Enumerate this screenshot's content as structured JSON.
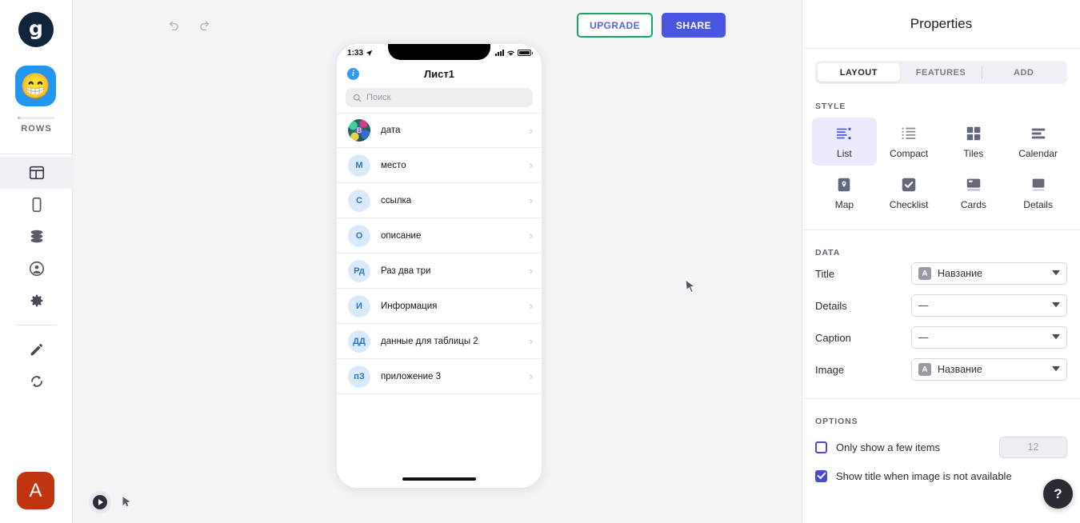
{
  "rail": {
    "brand_logo_letter": "g",
    "app_tile_emoji": "😁",
    "app_label": "ROWS",
    "icons": [
      {
        "name": "layout-icon",
        "label": "Layout",
        "active": true
      },
      {
        "name": "screen-icon",
        "label": "Screens",
        "active": false
      },
      {
        "name": "database-icon",
        "label": "Data",
        "active": false
      },
      {
        "name": "users-icon",
        "label": "Users",
        "active": false
      },
      {
        "name": "gear-icon",
        "label": "Settings",
        "active": false
      },
      {
        "name": "pencil-icon",
        "label": "Design",
        "active": false
      },
      {
        "name": "refresh-icon",
        "label": "Refresh",
        "active": false
      }
    ],
    "avatar_letter": "A",
    "avatar_color": "#c0340f"
  },
  "toolbar": {
    "undo_label": "Undo",
    "redo_label": "Redo",
    "upgrade_label": "UPGRADE",
    "share_label": "SHARE",
    "upgrade_border_color": "#17a762",
    "upgrade_text_color": "#5a62e8",
    "share_bg_color": "#4a56e2"
  },
  "preview": {
    "status_bar": {
      "time": "1:33",
      "location_arrow": "➤"
    },
    "nav_title": "Лист1",
    "info_letter": "i",
    "search_placeholder": "Поиск",
    "rows": [
      {
        "initials": "В",
        "label": "дата",
        "has_image": true
      },
      {
        "initials": "М",
        "label": "место",
        "has_image": false
      },
      {
        "initials": "С",
        "label": "ссылка",
        "has_image": false
      },
      {
        "initials": "О",
        "label": "описание",
        "has_image": false
      },
      {
        "initials": "Рд",
        "label": "Раз два три",
        "has_image": false
      },
      {
        "initials": "И",
        "label": "Информация",
        "has_image": false
      },
      {
        "initials": "ДД",
        "label": "данные для таблицы 2",
        "has_image": false
      },
      {
        "initials": "пЗ",
        "label": "приложение 3",
        "has_image": false
      }
    ],
    "chevron": "›"
  },
  "canvas_controls": {
    "play_label": "Preview",
    "pointer_label": "Select tool"
  },
  "panel": {
    "title": "Properties",
    "tabs": [
      {
        "label": "LAYOUT",
        "active": true
      },
      {
        "label": "FEATURES",
        "active": false
      },
      {
        "label": "ADD",
        "active": false
      }
    ],
    "style_section_label": "STYLE",
    "styles": [
      {
        "label": "List",
        "icon": "list-icon",
        "active": true
      },
      {
        "label": "Compact",
        "icon": "compact-icon",
        "active": false
      },
      {
        "label": "Tiles",
        "icon": "tiles-icon",
        "active": false
      },
      {
        "label": "Calendar",
        "icon": "calendar-icon",
        "active": false
      },
      {
        "label": "Map",
        "icon": "map-pin-icon",
        "active": false
      },
      {
        "label": "Checklist",
        "icon": "checklist-icon",
        "active": false
      },
      {
        "label": "Cards",
        "icon": "cards-icon",
        "active": false
      },
      {
        "label": "Details",
        "icon": "details-icon",
        "active": false
      }
    ],
    "data_section_label": "DATA",
    "fields": [
      {
        "label": "Title",
        "value": "Навзание",
        "badge": "A",
        "has_badge": true
      },
      {
        "label": "Details",
        "value": "—",
        "badge": "",
        "has_badge": false
      },
      {
        "label": "Caption",
        "value": "—",
        "badge": "",
        "has_badge": false
      },
      {
        "label": "Image",
        "value": "Название",
        "badge": "A",
        "has_badge": true
      }
    ],
    "options_section_label": "OPTIONS",
    "options": [
      {
        "label": "Only show a few items",
        "checked": false,
        "number_value": "12"
      },
      {
        "label": "Show title when image is not available",
        "checked": true
      }
    ],
    "active_style_bg": "#eceaff"
  },
  "help": {
    "label": "?"
  }
}
